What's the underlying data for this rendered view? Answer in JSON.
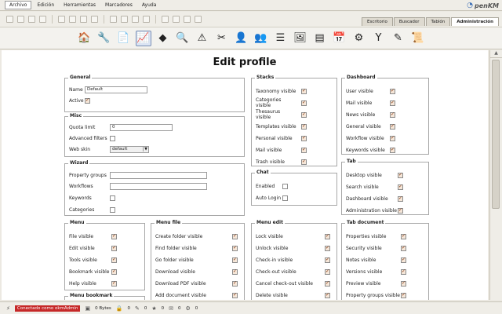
{
  "menubar": {
    "items": [
      "Archivo",
      "Edición",
      "Herramientas",
      "Marcadores",
      "Ayuda"
    ],
    "active_index": 0
  },
  "logo": {
    "text": "penKM"
  },
  "tabs": [
    {
      "label": "Escritorio",
      "active": false
    },
    {
      "label": "Buscador",
      "active": false
    },
    {
      "label": "Tablón",
      "active": false
    },
    {
      "label": "Administración",
      "active": true
    }
  ],
  "admin_icons": [
    "home-icon",
    "tools-icon",
    "document-icon",
    "monitor-icon",
    "diamond-icon",
    "search-icon",
    "warning-icon",
    "scissors-icon",
    "users-icon",
    "group-icon",
    "list-icon",
    "image-icon",
    "properties-icon",
    "calendar-icon",
    "gear-icon",
    "filter-icon",
    "translate-icon",
    "script-icon"
  ],
  "page": {
    "title": "Edit profile"
  },
  "general": {
    "title": "General",
    "name_label": "Name",
    "name_value": "Default",
    "active_label": "Active",
    "active_checked": true
  },
  "misc": {
    "title": "Misc",
    "quota_label": "Quota limit",
    "quota_value": "0",
    "advanced_label": "Advanced filters",
    "advanced_checked": false,
    "skin_label": "Web skin",
    "skin_value": "default"
  },
  "wizard": {
    "title": "Wizard",
    "items": [
      {
        "label": "Property groups",
        "type": "text"
      },
      {
        "label": "Workflows",
        "type": "text"
      },
      {
        "label": "Keywords",
        "type": "check",
        "checked": false
      },
      {
        "label": "Categories",
        "type": "check",
        "checked": false
      }
    ]
  },
  "stacks": {
    "title": "Stacks",
    "items": [
      {
        "label": "Taxonomy visible",
        "checked": true
      },
      {
        "label": "Categories visible",
        "checked": true
      },
      {
        "label": "Thesaurus visible",
        "checked": true
      },
      {
        "label": "Templates visible",
        "checked": true
      },
      {
        "label": "Personal visible",
        "checked": true
      },
      {
        "label": "Mail visible",
        "checked": true
      },
      {
        "label": "Trash visible",
        "checked": true
      }
    ]
  },
  "chat": {
    "title": "Chat",
    "items": [
      {
        "label": "Enabled",
        "checked": false
      },
      {
        "label": "Auto Login",
        "checked": false
      }
    ]
  },
  "dashboard": {
    "title": "Dashboard",
    "items": [
      {
        "label": "User visible",
        "checked": true
      },
      {
        "label": "Mail visible",
        "checked": true
      },
      {
        "label": "News visible",
        "checked": true
      },
      {
        "label": "General visible",
        "checked": true
      },
      {
        "label": "Workflow visible",
        "checked": true
      },
      {
        "label": "Keywords visible",
        "checked": true
      }
    ]
  },
  "tab": {
    "title": "Tab",
    "items": [
      {
        "label": "Desktop visible",
        "checked": true
      },
      {
        "label": "Search visible",
        "checked": true
      },
      {
        "label": "Dashboard visible",
        "checked": true
      },
      {
        "label": "Administration visible",
        "checked": true
      }
    ]
  },
  "menu": {
    "title": "Menu",
    "items": [
      {
        "label": "File visible",
        "checked": true
      },
      {
        "label": "Edit visible",
        "checked": true
      },
      {
        "label": "Tools visible",
        "checked": true
      },
      {
        "label": "Bookmark visible",
        "checked": true
      },
      {
        "label": "Help visible",
        "checked": true
      }
    ]
  },
  "menu_file": {
    "title": "Menu file",
    "items": [
      {
        "label": "Create folder visible",
        "checked": true
      },
      {
        "label": "Find folder visible",
        "checked": true
      },
      {
        "label": "Go folder visible",
        "checked": true
      },
      {
        "label": "Download visible",
        "checked": true
      },
      {
        "label": "Download PDF visible",
        "checked": true
      },
      {
        "label": "Add document visible",
        "checked": true
      }
    ]
  },
  "menu_edit": {
    "title": "Menu edit",
    "items": [
      {
        "label": "Lock visible",
        "checked": true
      },
      {
        "label": "Unlock visible",
        "checked": true
      },
      {
        "label": "Check-in visible",
        "checked": true
      },
      {
        "label": "Check-out visible",
        "checked": true
      },
      {
        "label": "Cancel check-out visible",
        "checked": true
      },
      {
        "label": "Delete visible",
        "checked": true
      }
    ]
  },
  "tab_document": {
    "title": "Tab document",
    "items": [
      {
        "label": "Properties visible",
        "checked": true
      },
      {
        "label": "Security visible",
        "checked": true
      },
      {
        "label": "Notes visible",
        "checked": true
      },
      {
        "label": "Versions visible",
        "checked": true
      },
      {
        "label": "Preview visible",
        "checked": true
      },
      {
        "label": "Property groups visible",
        "checked": true
      }
    ]
  },
  "menu_bookmark": {
    "title": "Menu bookmark"
  },
  "status": {
    "connection": "Conectado como okmAdmin",
    "size": "0 Bytes",
    "counts": [
      "0",
      "0",
      "0",
      "0",
      "0"
    ]
  }
}
